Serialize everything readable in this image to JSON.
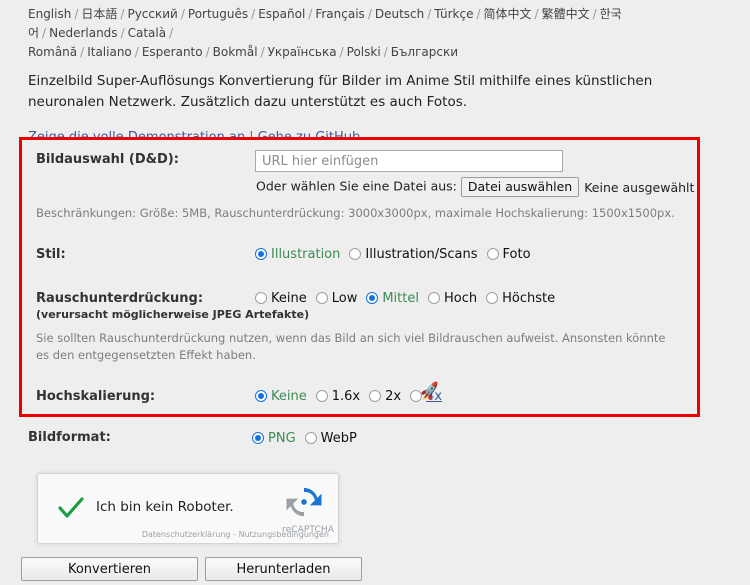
{
  "languages": {
    "row1": [
      "English",
      "日本語",
      "Русский",
      "Português",
      "Español",
      "Français",
      "Deutsch",
      "Türkçe",
      "简体中文",
      "繁體中文",
      "한국어",
      "Nederlands",
      "Català"
    ],
    "row2": [
      "Română",
      "Italiano",
      "Esperanto",
      "Bokmål",
      "Українська",
      "Polski",
      "Български"
    ],
    "separator": "/"
  },
  "intro": {
    "paragraph": "Einzelbild Super-Auflösungs Konvertierung für Bilder im Anime Stil mithilfe eines künstlichen neuronalen Netzwerk. Zusätzlich dazu unterstützt es auch Fotos.",
    "link_demo": "Zeige die volle Demonstration an",
    "link_separator": "|",
    "link_github": "Gehe zu GitHub"
  },
  "form": {
    "image_select": {
      "label": "Bildauswahl (D&D):",
      "url_placeholder": "URL hier einfügen",
      "url_value": "",
      "or_choose_file": "Oder wählen Sie eine Datei aus:",
      "file_button": "Datei auswählen",
      "file_status": "Keine ausgewählt",
      "restrictions": "Beschränkungen: Größe: 5MB, Rauschunterdrückung: 3000x3000px, maximale Hochskalierung: 1500x1500px."
    },
    "style": {
      "label": "Stil:",
      "options": [
        {
          "label": "Illustration",
          "selected": true
        },
        {
          "label": "Illustration/Scans",
          "selected": false
        },
        {
          "label": "Foto",
          "selected": false
        }
      ]
    },
    "noise": {
      "label": "Rauschunterdrückung:",
      "sublabel": "(verursacht möglicherweise JPEG Artefakte)",
      "options": [
        {
          "label": "Keine",
          "selected": false
        },
        {
          "label": "Low",
          "selected": false
        },
        {
          "label": "Mittel",
          "selected": true
        },
        {
          "label": "Hoch",
          "selected": false
        },
        {
          "label": "Höchste",
          "selected": false
        }
      ],
      "hint": "Sie sollten Rauschunterdrückung nutzen, wenn das Bild an sich viel Bildrauschen aufweist. Ansonsten könnte es den entgegensetzten Effekt haben."
    },
    "upscale": {
      "label": "Hochskalierung:",
      "options": [
        {
          "label": "Keine",
          "selected": true
        },
        {
          "label": "1.6x",
          "selected": false
        },
        {
          "label": "2x",
          "selected": false
        },
        {
          "label": "4x",
          "selected": false
        }
      ]
    },
    "format": {
      "label": "Bildformat:",
      "options": [
        {
          "label": "PNG",
          "selected": true
        },
        {
          "label": "WebP",
          "selected": false
        }
      ]
    }
  },
  "cursor": {
    "icon": "🚀"
  },
  "recaptcha": {
    "checkbox_label": "Ich bin kein Roboter.",
    "verified": true,
    "brand": "reCAPTCHA",
    "privacy": "Datenschutzerklärung",
    "legal_separator": "-",
    "terms": "Nutzungsbedingungen"
  },
  "actions": {
    "convert": "Konvertieren",
    "download": "Herunterladen"
  },
  "colors": {
    "highlight_border": "#ee0000",
    "radio_selected": "#1272e0",
    "selected_label": "#3d8b54",
    "link": "#3b5998",
    "background": "#eeeeee"
  }
}
